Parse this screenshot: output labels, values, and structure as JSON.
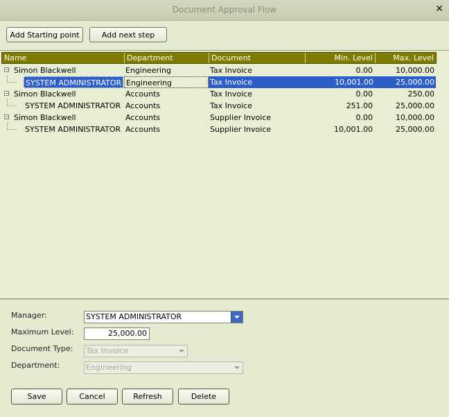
{
  "window": {
    "title": "Document Approval Flow"
  },
  "toolbar": {
    "add_start_label": "Add Starting point",
    "add_next_label": "Add next step"
  },
  "grid": {
    "columns": [
      "Name",
      "Department",
      "Document",
      "Min. Level",
      "Max. Level"
    ],
    "rows": [
      {
        "name": "Simon Blackwell",
        "department": "Engineering",
        "document": "Tax Invoice",
        "min": "0.00",
        "max": "10,000.00"
      },
      {
        "name": "SYSTEM ADMINISTRATOR",
        "department": "Engineering",
        "document": "Tax Invoice",
        "min": "10,001.00",
        "max": "25,000.00"
      },
      {
        "name": "Simon Blackwell",
        "department": "Accounts",
        "document": "Tax Invoice",
        "min": "0.00",
        "max": "250.00"
      },
      {
        "name": "SYSTEM ADMINISTRATOR",
        "department": "Accounts",
        "document": "Tax Invoice",
        "min": "251.00",
        "max": "25,000.00"
      },
      {
        "name": "Simon Blackwell",
        "department": "Accounts",
        "document": "Supplier Invoice",
        "min": "0.00",
        "max": "10,000.00"
      },
      {
        "name": "SYSTEM ADMINISTRATOR",
        "department": "Accounts",
        "document": "Supplier Invoice",
        "min": "10,001.00",
        "max": "25,000.00"
      }
    ]
  },
  "form": {
    "manager_label": "Manager:",
    "manager_value": "SYSTEM ADMINISTRATOR",
    "max_level_label": "Maximum Level:",
    "max_level_value": "25,000.00",
    "doc_type_label": "Document Type:",
    "doc_type_value": "Tax Invoice",
    "department_label": "Department:",
    "department_value": "Engineering"
  },
  "actions": {
    "save": "Save",
    "cancel": "Cancel",
    "refresh": "Refresh",
    "delete": "Delete"
  }
}
